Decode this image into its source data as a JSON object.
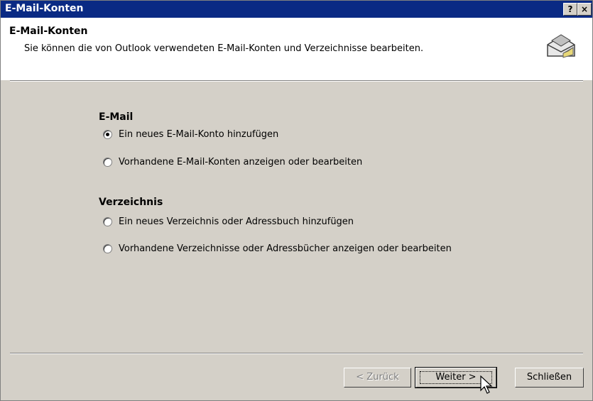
{
  "window": {
    "title": "E-Mail-Konten",
    "help_glyph": "?",
    "close_glyph": "×"
  },
  "header": {
    "title": "E-Mail-Konten",
    "subtitle": "Sie können die von Outlook verwendeten E-Mail-Konten und Verzeichnisse bearbeiten."
  },
  "email": {
    "label": "E-Mail",
    "options": [
      {
        "label": "Ein neues E-Mail-Konto hinzufügen",
        "checked": true
      },
      {
        "label": "Vorhandene E-Mail-Konten anzeigen oder bearbeiten",
        "checked": false
      }
    ]
  },
  "directory": {
    "label": "Verzeichnis",
    "options": [
      {
        "label": "Ein neues Verzeichnis oder Adressbuch hinzufügen",
        "checked": false
      },
      {
        "label": "Vorhandene Verzeichnisse oder Adressbücher anzeigen oder bearbeiten",
        "checked": false
      }
    ]
  },
  "buttons": {
    "back": "< Zurück",
    "next": "Weiter >",
    "close": "Schließen"
  },
  "icons": {
    "header": "mail-accounts-icon",
    "cursor": "mouse-pointer-icon"
  }
}
